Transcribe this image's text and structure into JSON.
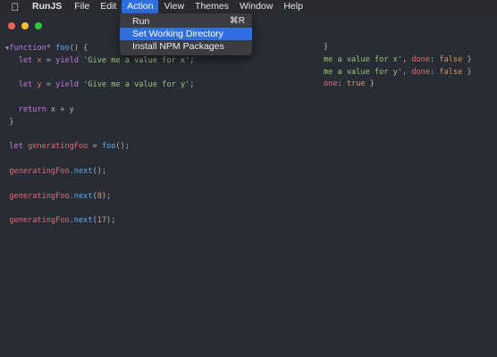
{
  "menubar": {
    "apple_icon": "apple-icon",
    "items": [
      "RunJS",
      "File",
      "Edit",
      "Action",
      "View",
      "Themes",
      "Window",
      "Help"
    ],
    "active_item": "Action"
  },
  "action_menu": {
    "items": [
      {
        "label": "Run",
        "shortcut": "⌘R"
      },
      {
        "label": "Set Working Directory",
        "shortcut": ""
      },
      {
        "label": "Install NPM Packages",
        "shortcut": ""
      }
    ],
    "highlighted": "Set Working Directory"
  },
  "colors": {
    "menu_highlight": "#2f6fe0",
    "editor_background": "#282c34",
    "traffic_red": "#fe5f57",
    "traffic_yellow": "#febc2e",
    "traffic_green": "#28c840"
  },
  "code": {
    "l1_kw": "function*",
    "l1_fn": "foo",
    "l1_rest": "() {",
    "l2_kw": "let",
    "l2_var": "x",
    "l2_eq": " = ",
    "l2_kw2": "yield",
    "l2_str": "'Give me a value for x'",
    "l2_end": ";",
    "l4_kw": "let",
    "l4_var": "y",
    "l4_eq": " = ",
    "l4_kw2": "yield",
    "l4_str": "'Give me a value for y'",
    "l4_end": ";",
    "l6_kw": "return",
    "l6_rest": " x + y",
    "l7": "}",
    "l9_kw": "let",
    "l9_var": "generatingFoo",
    "l9_eq": " = ",
    "l9_fn": "foo",
    "l9_end": "();",
    "l11_obj": "generatingFoo",
    "l11_fn": ".next",
    "l11_end": "();",
    "l13_obj": "generatingFoo",
    "l13_fn": ".next",
    "l13_open": "(",
    "l13_num": "8",
    "l13_close": ");",
    "l15_obj": "generatingFoo",
    "l15_fn": ".next",
    "l15_open": "(",
    "l15_num": "17",
    "l15_close": ");"
  },
  "results": {
    "r1_frag": "}",
    "r2_text": "me a value for x'",
    "r2_key": "done",
    "r2_val": "false",
    "r3_text": "me a value for y'",
    "r3_key": "done",
    "r3_val": "false",
    "r4_key": "one",
    "r4_val": "true"
  }
}
